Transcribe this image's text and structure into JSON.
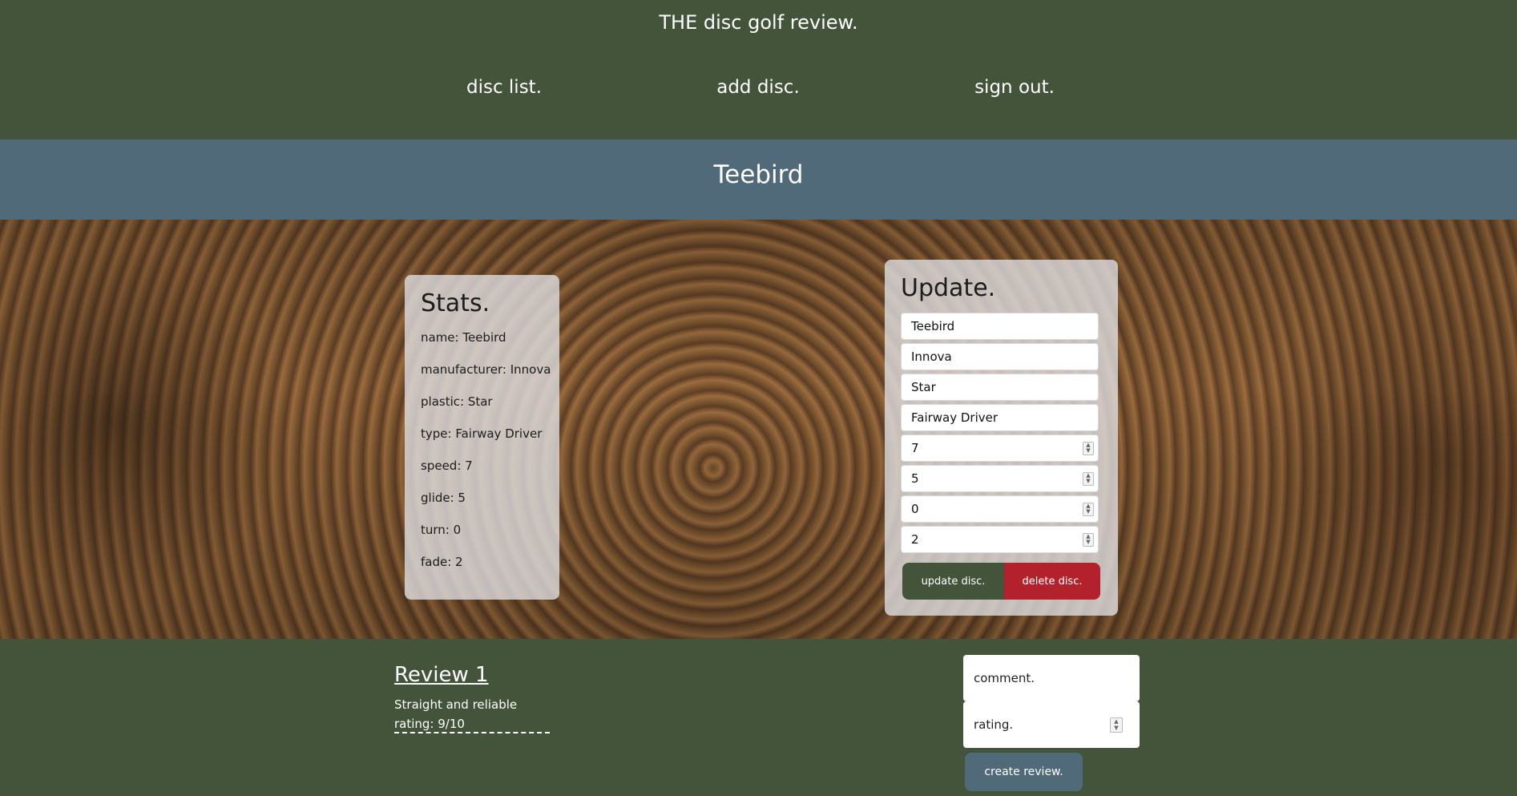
{
  "header": {
    "site_title": "THE disc golf review.",
    "nav": [
      "disc list.",
      "add disc.",
      "sign out."
    ]
  },
  "disc": {
    "title": "Teebird"
  },
  "stats": {
    "heading": "Stats.",
    "lines": [
      "name: Teebird",
      "manufacturer: Innova",
      "plastic: Star",
      "type: Fairway Driver",
      "speed: 7",
      "glide: 5",
      "turn: 0",
      "fade: 2"
    ]
  },
  "update_form": {
    "heading": "Update.",
    "name": "Teebird",
    "manufacturer": "Innova",
    "plastic": "Star",
    "type": "Fairway Driver",
    "speed": "7",
    "glide": "5",
    "turn": "0",
    "fade": "2",
    "update_label": "update disc.",
    "delete_label": "delete disc."
  },
  "reviews": {
    "items": [
      {
        "title": "Review 1",
        "comment": "Straight and reliable",
        "rating": "rating: 9/10"
      }
    ],
    "divider": "----------------------------------------"
  },
  "review_form": {
    "comment_placeholder": "comment.",
    "rating_placeholder": "rating.",
    "submit_label": "create review."
  },
  "colors": {
    "header_green": "#43543b",
    "title_bar": "#516a7a",
    "delete_red": "#b3222c"
  }
}
